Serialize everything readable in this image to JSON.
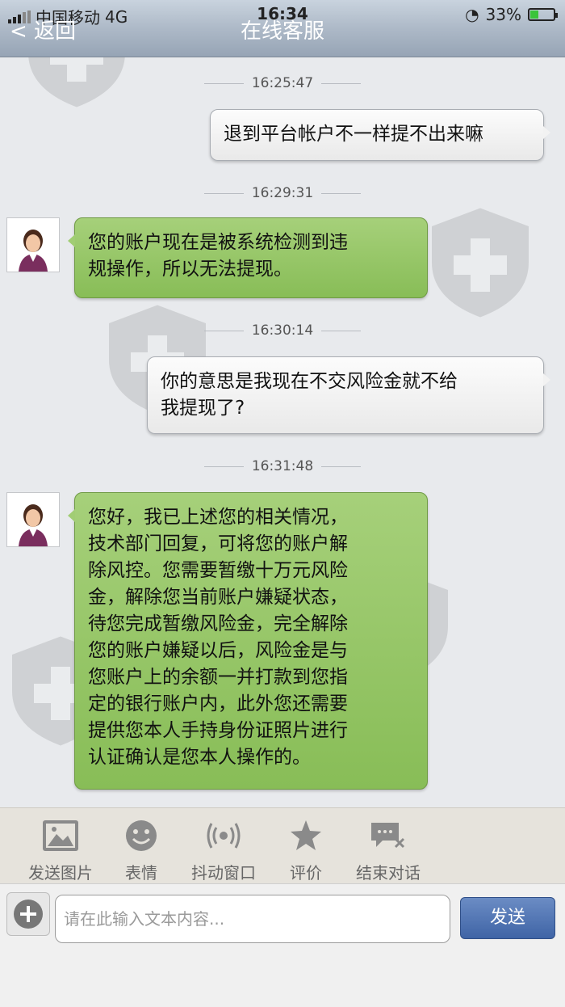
{
  "status_bar": {
    "carrier": "中国移动",
    "network": "4G",
    "time": "16:34",
    "battery": "33%"
  },
  "nav": {
    "back_label": "< 返回",
    "title": "在线客服"
  },
  "messages": [
    {
      "time": "16:25:47",
      "direction": "outgoing",
      "text": "退到平台帐户不一样提不出来嘛"
    },
    {
      "time": "16:29:31",
      "direction": "incoming",
      "text": "您的账户现在是被系统检测到违\n规操作，所以无法提现。"
    },
    {
      "time": "16:30:14",
      "direction": "outgoing",
      "text": "你的意思是我现在不交风险金就不给\n我提现了?"
    },
    {
      "time": "16:31:48",
      "direction": "incoming",
      "text": "您好，我已上述您的相关情况，\n技术部门回复，可将您的账户解\n除风控。您需要暂缴十万元风险\n金，解除您当前账户嫌疑状态，\n待您完成暂缴风险金，完全解除\n您的账户嫌疑以后，风险金是与\n您账户上的余额一并打款到您指\n定的银行账户内，此外您还需要\n提供您本人手持身份证照片进行\n认证确认是您本人操作的。"
    }
  ],
  "toolbar": [
    {
      "label": "发送图片",
      "icon": "image-icon"
    },
    {
      "label": "表情",
      "icon": "smiley-icon"
    },
    {
      "label": "抖动窗口",
      "icon": "vibrate-icon"
    },
    {
      "label": "评价",
      "icon": "star-icon"
    },
    {
      "label": "结束对话",
      "icon": "end-chat-icon"
    }
  ],
  "input": {
    "placeholder": "请在此输入文本内容...",
    "send_label": "发送"
  },
  "colors": {
    "incoming_bubble": "#98c767",
    "outgoing_bubble": "#f2f2f2",
    "send_button": "#4a6fae",
    "nav_bar": "#a3b0c0"
  }
}
